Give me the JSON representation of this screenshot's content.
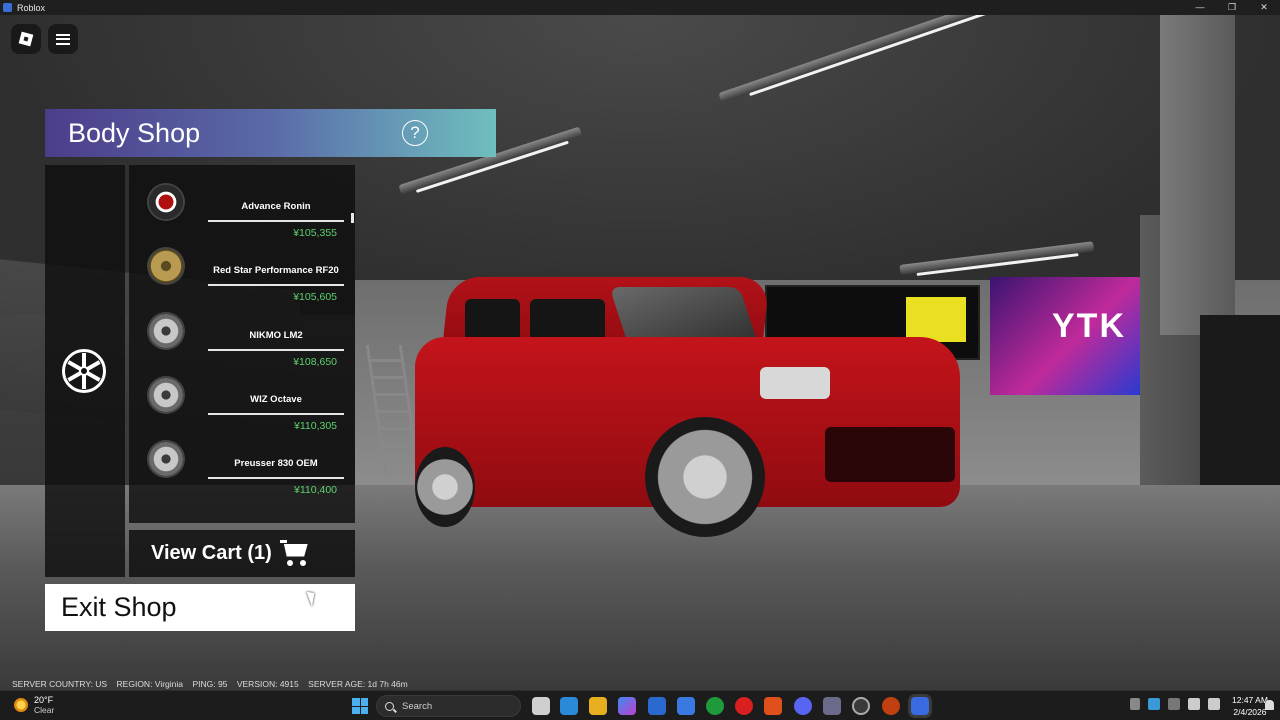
{
  "window": {
    "title": "Roblox"
  },
  "shop": {
    "title": "Body Shop",
    "help_label": "?",
    "items": [
      {
        "name": "Advance Ronin",
        "price": "¥105,355",
        "icon": "wheel-red-icon"
      },
      {
        "name": "Red Star Performance RF20",
        "price": "¥105,605",
        "icon": "wheel-gold-icon"
      },
      {
        "name": "NIKMO LM2",
        "price": "¥108,650",
        "icon": "wheel-silver-icon"
      },
      {
        "name": "WIZ Octave",
        "price": "¥110,305",
        "icon": "wheel-silver-icon"
      },
      {
        "name": "Preusser 830 OEM",
        "price": "¥110,400",
        "icon": "wheel-silver-icon"
      }
    ],
    "cart_label": "View Cart (1)",
    "exit_label": "Exit Shop"
  },
  "scene": {
    "sign_text": "YTK"
  },
  "server_info": "SERVER COUNTRY: US    REGION: Virginia    PING: 95    VERSION: 4915    SERVER AGE: 1d 7h 46m",
  "taskbar": {
    "weather_temp": "20°F",
    "weather_condition": "Clear",
    "search_placeholder": "Search",
    "time": "12:47 AM",
    "date": "2/4/2026"
  },
  "colors": {
    "price_green": "#5dd16e",
    "header_gradient_start": "#4c3d8a",
    "header_gradient_end": "#6fbfbf"
  }
}
